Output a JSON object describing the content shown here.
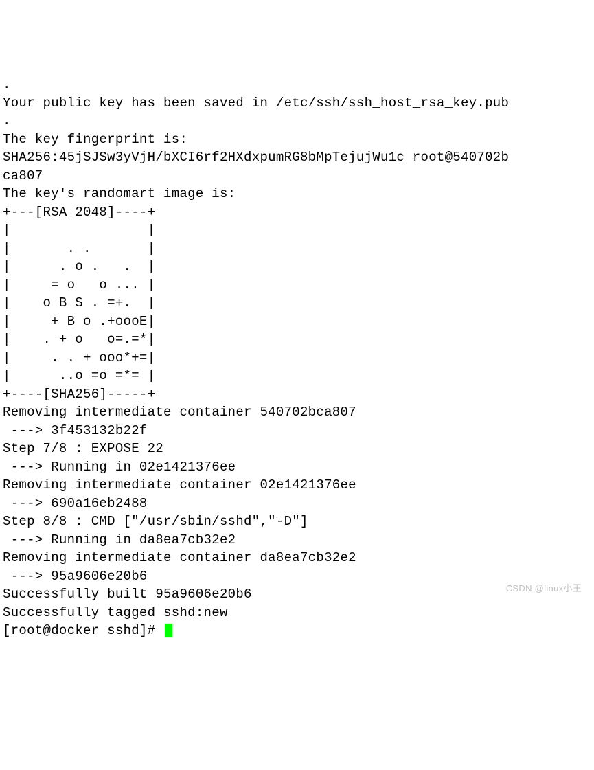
{
  "terminal": {
    "lines": [
      ".",
      "Your public key has been saved in /etc/ssh/ssh_host_rsa_key.pub",
      ".",
      "The key fingerprint is:",
      "SHA256:45jSJSw3yVjH/bXCI6rf2HXdxpumRG8bMpTejujWu1c root@540702b",
      "ca807",
      "The key's randomart image is:",
      "+---[RSA 2048]----+",
      "|                 |",
      "|       . .       |",
      "|      . o .   .  |",
      "|     = o   o ... |",
      "|    o B S . =+.  |",
      "|     + B o .+oooE|",
      "|    . + o   o=.=*|",
      "|     . . + ooo*+=|",
      "|      ..o =o =*= |",
      "+----[SHA256]-----+",
      "Removing intermediate container 540702bca807",
      " ---> 3f453132b22f",
      "Step 7/8 : EXPOSE 22",
      " ---> Running in 02e1421376ee",
      "Removing intermediate container 02e1421376ee",
      " ---> 690a16eb2488",
      "Step 8/8 : CMD [\"/usr/sbin/sshd\",\"-D\"]",
      " ---> Running in da8ea7cb32e2",
      "Removing intermediate container da8ea7cb32e2",
      " ---> 95a9606e20b6",
      "Successfully built 95a9606e20b6",
      "Successfully tagged sshd:new"
    ],
    "prompt": "[root@docker sshd]# "
  },
  "watermark": "CSDN @linux小王"
}
